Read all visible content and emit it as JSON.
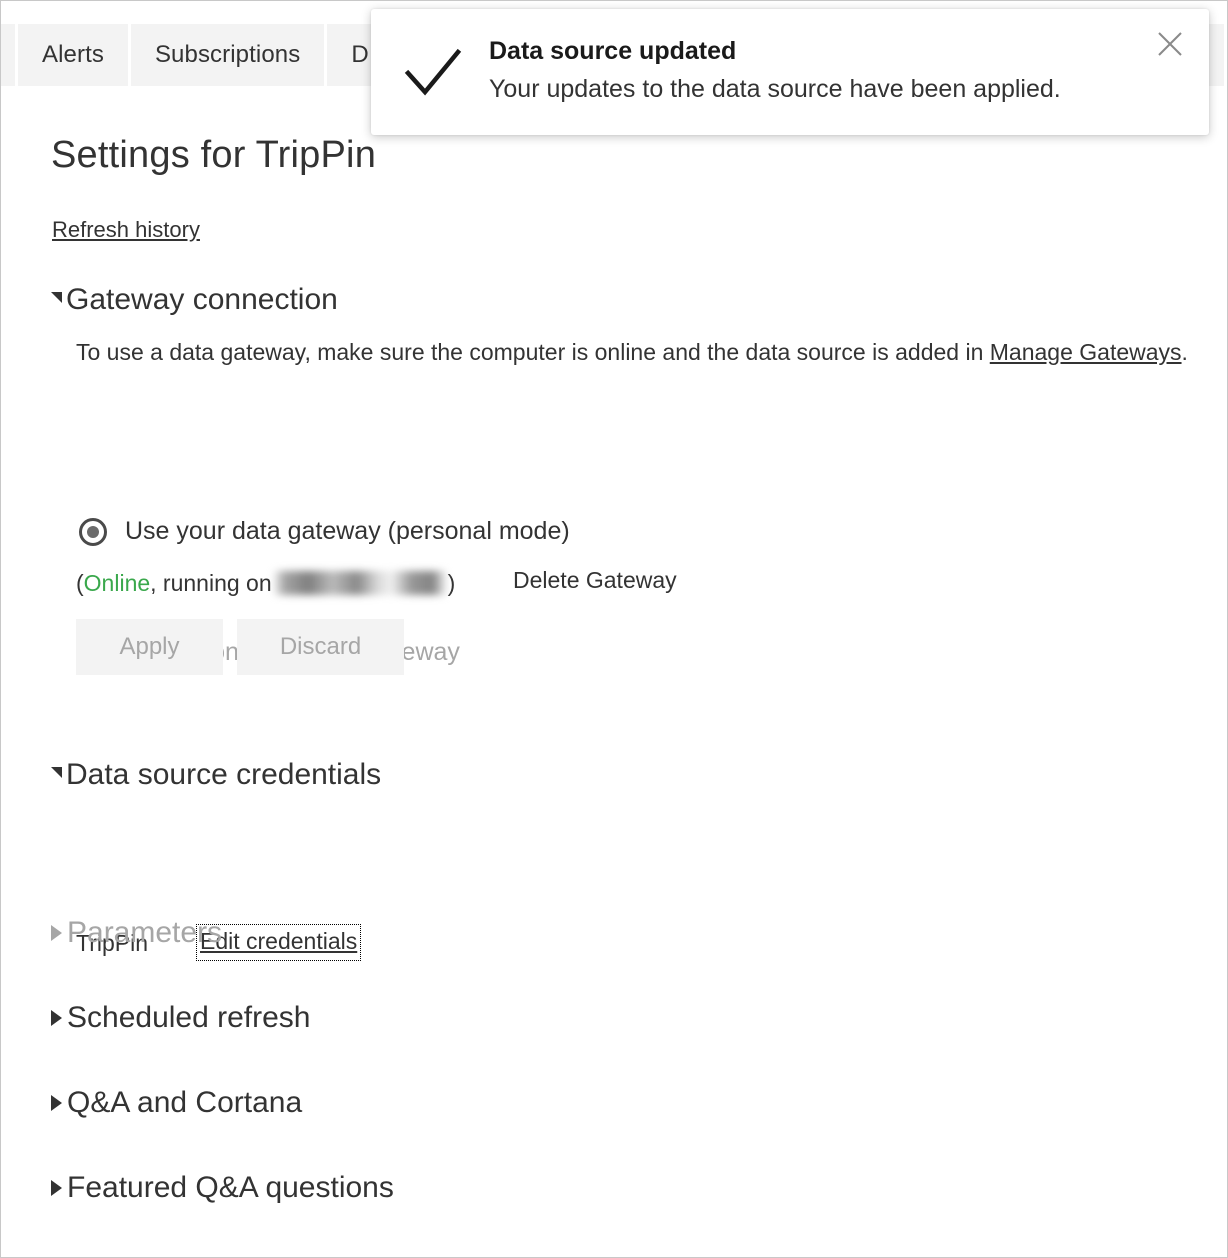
{
  "tabs": [
    {
      "label": "",
      "partial": true
    },
    {
      "label": "Alerts"
    },
    {
      "label": "Subscriptions"
    },
    {
      "label": "D"
    }
  ],
  "page": {
    "title": "Settings for TripPin",
    "refresh_history_link": "Refresh history"
  },
  "gateway": {
    "section_title": "Gateway connection",
    "description_pre": "To use a data gateway, make sure the computer is online and the data source is added in ",
    "description_link": "Manage Gateways",
    "description_post": ".",
    "option_personal": "Use your data gateway (personal mode)",
    "option_onprem": "Use an on-prem data gateway",
    "status_open_paren": "(",
    "status_online": "Online",
    "status_running_on": ", running on ",
    "status_close_paren": ")",
    "delete_gateway_link": "Delete Gateway",
    "apply_button": "Apply",
    "discard_button": "Discard",
    "online_color": "#3aa84c"
  },
  "credentials": {
    "section_title": "Data source credentials",
    "source_name": "TripPin",
    "edit_link": "Edit credentials"
  },
  "sections": [
    {
      "title": "Parameters",
      "disabled": true
    },
    {
      "title": "Scheduled refresh",
      "disabled": false
    },
    {
      "title": "Q&A and Cortana",
      "disabled": false
    },
    {
      "title": "Featured Q&A questions",
      "disabled": false
    }
  ],
  "toast": {
    "title": "Data source updated",
    "message": "Your updates to the data source have been applied.",
    "icon": "checkmark-icon",
    "close_icon": "close-icon"
  }
}
